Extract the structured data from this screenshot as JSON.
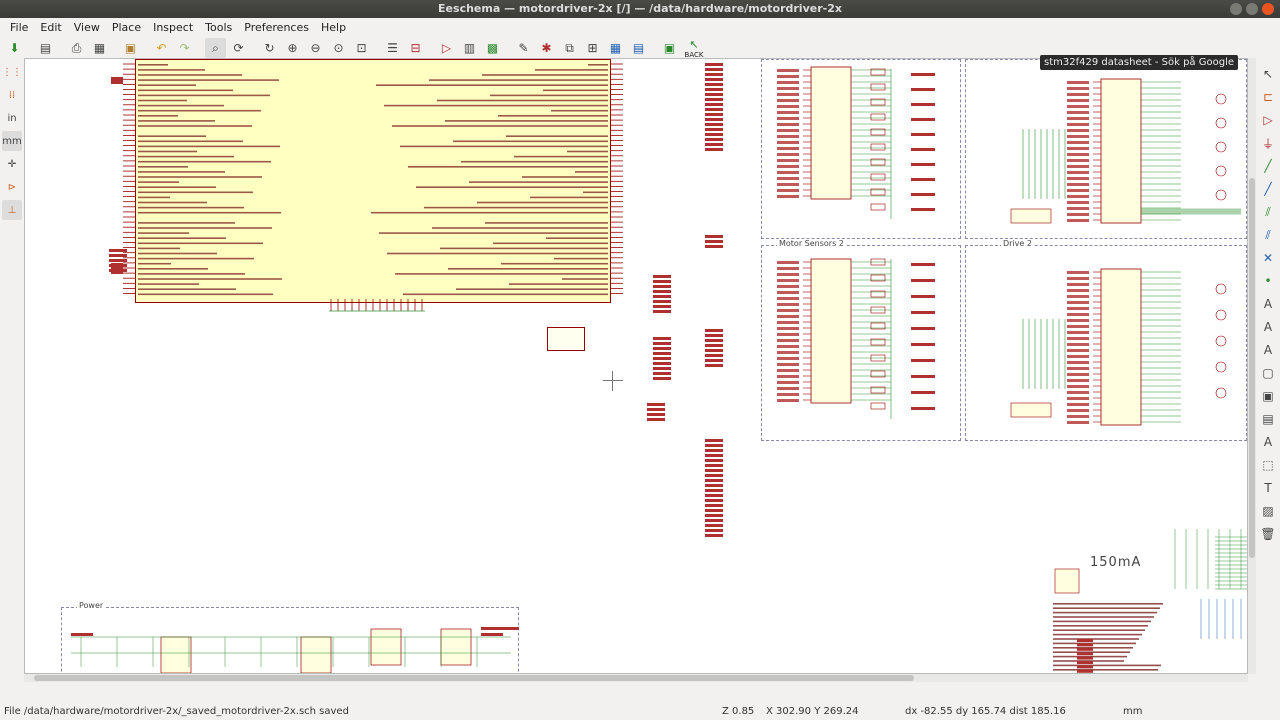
{
  "window": {
    "title": "Eeschema — motordriver-2x [/] — /data/hardware/motordriver-2x"
  },
  "menu": [
    "File",
    "Edit",
    "View",
    "Place",
    "Inspect",
    "Tools",
    "Preferences",
    "Help"
  ],
  "toolbar": {
    "icons": [
      "new-sheet-icon",
      "page-settings-icon",
      "print-icon",
      "plot-icon",
      "paste-icon",
      "undo-icon",
      "redo-icon",
      "find-icon",
      "find-replace-icon",
      "refresh-icon",
      "zoom-in-icon",
      "zoom-out-icon",
      "zoom-fit-icon",
      "zoom-selection-icon",
      "hierarchy-icon",
      "leave-sheet-icon",
      "symbol-editor-icon",
      "symbol-browser-icon",
      "footprint-assign-icon",
      "annotate-icon",
      "erc-icon",
      "netlist-icon",
      "assign-footprints-icon",
      "bom-icon",
      "edit-fields-icon",
      "pcbnew-icon"
    ],
    "back_label": "BACK"
  },
  "left_toolbar": {
    "unit_in": "in",
    "unit_mm": "mm"
  },
  "tooltip": "stm32f429 datasheet - Sök på Google",
  "canvas": {
    "sheet_titles": {
      "motor_sensors_2": "Motor Sensors 2",
      "drive_2": "Drive 2",
      "power": "Power"
    },
    "current_label": "150mA"
  },
  "status": {
    "file": "File /data/hardware/motordriver-2x/_saved_motordriver-2x.sch saved",
    "zoom": "Z 0.85",
    "coords": "X 302.90  Y 269.24",
    "delta": "dx -82.55  dy 165.74  dist 185.16",
    "units": "mm"
  },
  "colors": {
    "component_fill": "#ffffc2",
    "component_outline": "#9a0000",
    "wire": "#2f8f2f",
    "label": "#b03030",
    "canvas_bg": "#ffffff"
  }
}
